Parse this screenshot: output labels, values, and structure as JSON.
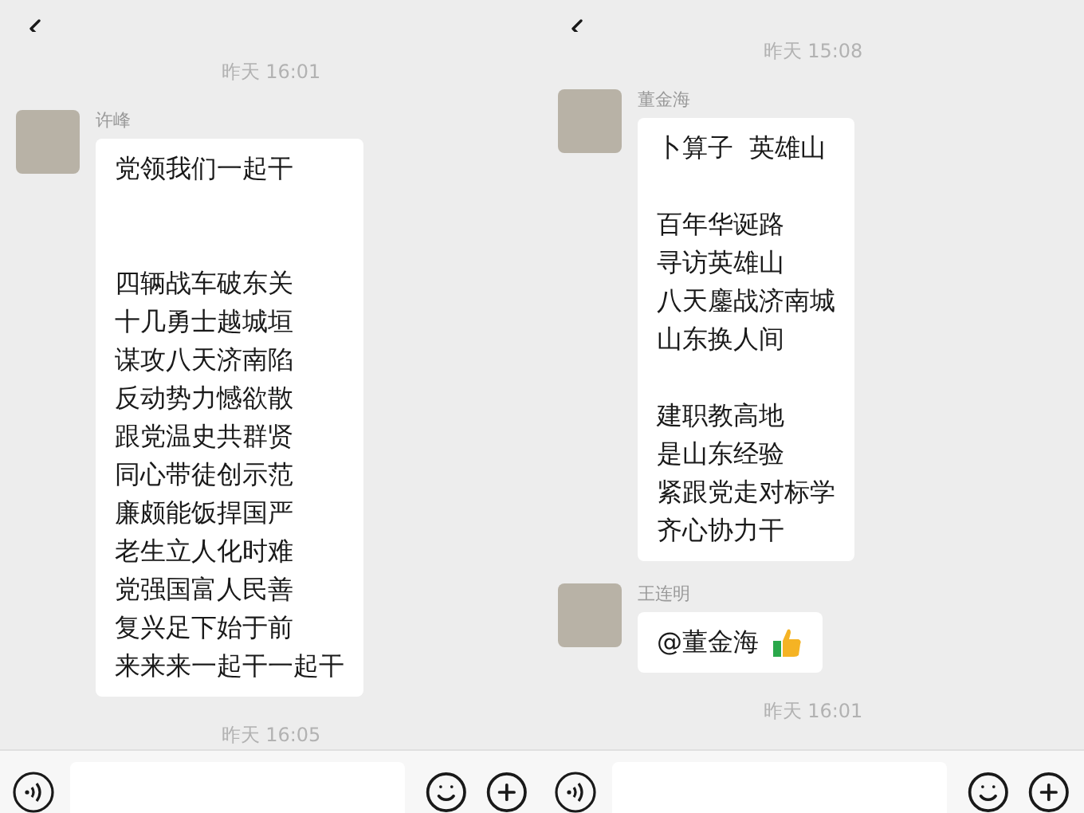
{
  "panes": [
    {
      "items": [
        {
          "kind": "time",
          "text": "昨天 16:01"
        },
        {
          "kind": "message",
          "sender": "许峰",
          "thumbs_up": false,
          "stanzas": [
            [
              "党领我们一起干"
            ],
            [
              "四辆战车破东关",
              "十几勇士越城垣",
              "谋攻八天济南陷",
              "反动势力憾欲散",
              "跟党温史共群贤",
              "同心带徒创示范",
              "廉颇能饭捍国严",
              "老生立人化时难",
              "党强国富人民善",
              "复兴足下始于前",
              "来来来一起干一起干"
            ]
          ]
        },
        {
          "kind": "time",
          "text": "昨天 16:05"
        }
      ]
    },
    {
      "items": [
        {
          "kind": "time",
          "text": "昨天 15:08"
        },
        {
          "kind": "message",
          "sender": "董金海",
          "thumbs_up": false,
          "stanzas": [
            [
              "卜算子  英雄山"
            ],
            [
              "百年华诞路",
              "寻访英雄山",
              "八天鏖战济南城",
              "山东换人间"
            ],
            [
              "建职教高地",
              "是山东经验",
              "紧跟党走对标学",
              "齐心协力干"
            ]
          ]
        },
        {
          "kind": "message",
          "sender": "王连明",
          "thumbs_up": true,
          "stanzas": [
            [
              "@董金海"
            ]
          ]
        },
        {
          "kind": "time",
          "text": "昨天 16:01"
        }
      ]
    }
  ]
}
